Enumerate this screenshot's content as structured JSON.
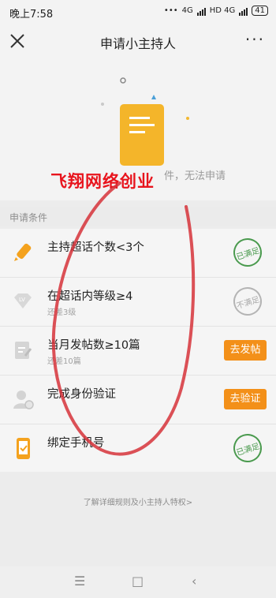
{
  "status": {
    "time": "晚上7:58",
    "icons_text": "•••",
    "net1": "4G",
    "net2": "HD 4G",
    "battery": "41"
  },
  "nav": {
    "title": "申请小主持人",
    "more": "···"
  },
  "hero": {
    "message": "件，无法申请",
    "watermark": "飞翔网络创业"
  },
  "section": {
    "label": "申请条件"
  },
  "conditions": [
    {
      "title": "主持超话个数<3个",
      "sub": "",
      "status": "已满足",
      "icon": "pen-icon"
    },
    {
      "title": "在超话内等级≥4",
      "sub": "还差3级",
      "status": "不满足",
      "icon": "level-icon"
    },
    {
      "title": "当月发帖数≥10篇",
      "sub": "还差10篇",
      "action": "去发帖",
      "icon": "post-icon"
    },
    {
      "title": "完成身份验证",
      "sub": "",
      "action": "去验证",
      "icon": "id-icon"
    },
    {
      "title": "绑定手机号",
      "sub": "",
      "status": "已满足",
      "icon": "phone-icon"
    }
  ],
  "footer": {
    "link": "了解详细规则及小主持人特权>"
  },
  "colors": {
    "accent": "#f39019",
    "ok": "#4a9a4e",
    "red_mark": "#d6323a"
  }
}
